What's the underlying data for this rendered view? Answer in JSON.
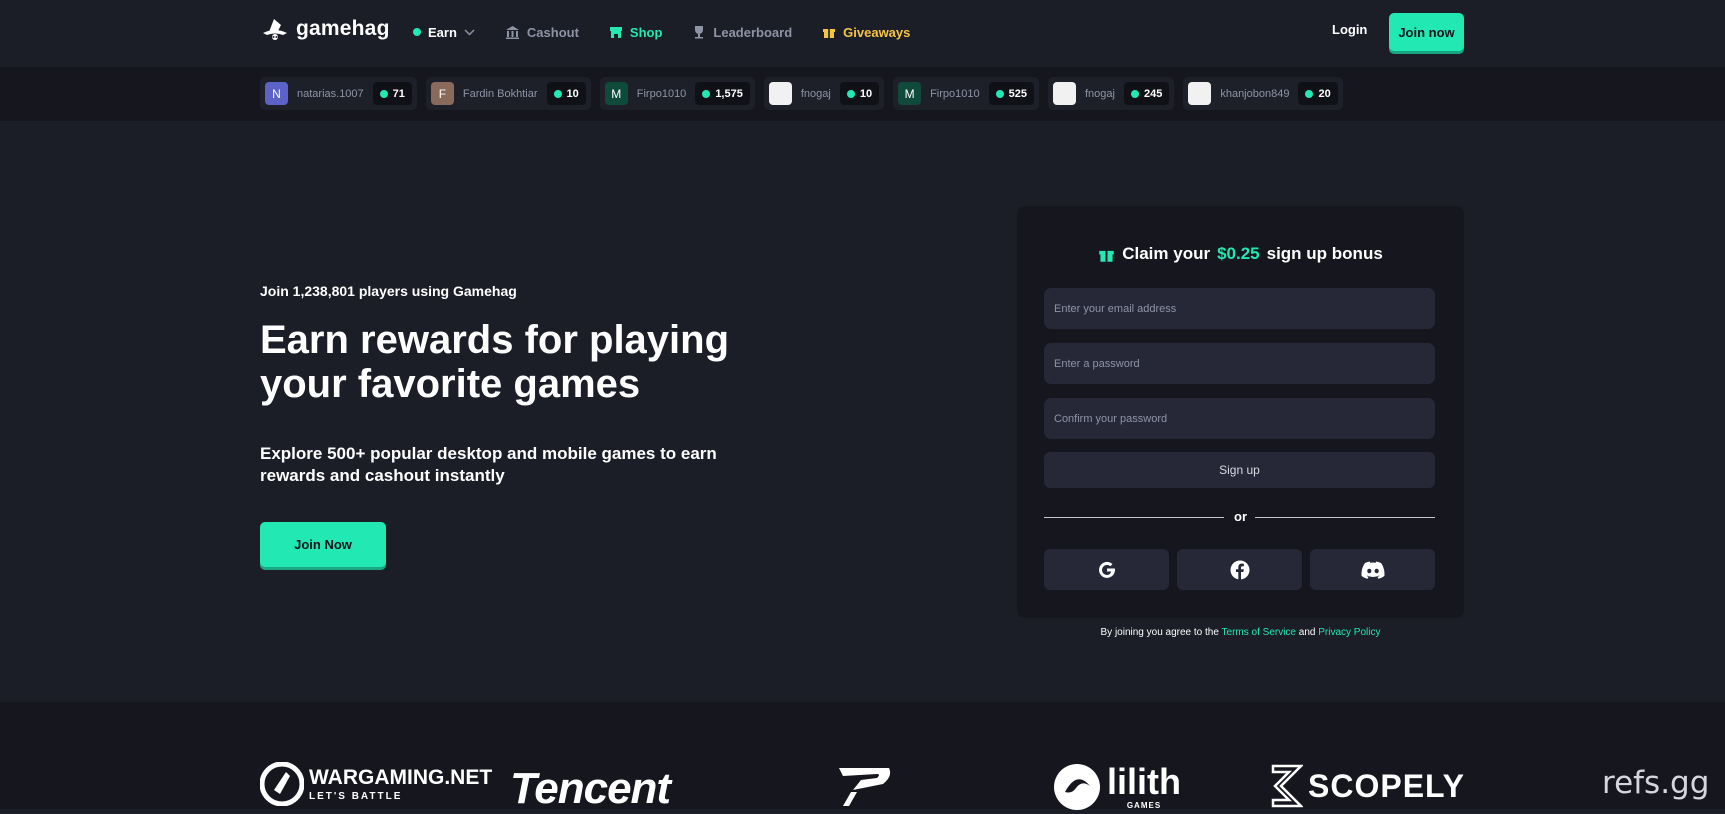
{
  "nav": {
    "logo_text": "gamehag",
    "earn": "Earn",
    "cashout": "Cashout",
    "shop": "Shop",
    "leaderboard": "Leaderboard",
    "giveaways": "Giveaways",
    "login": "Login",
    "join": "Join now"
  },
  "ticker": [
    {
      "initial": "N",
      "name": "natarias.1007",
      "value": "71",
      "color": "#5b63c8"
    },
    {
      "initial": "F",
      "name": "Fardin Bokhtiar",
      "value": "10",
      "color": "#8a6a5a"
    },
    {
      "initial": "M",
      "name": "Firpo1010",
      "value": "1,575",
      "color": "#0f4a3a"
    },
    {
      "initial": "",
      "name": "fnogaj",
      "value": "10",
      "color": "#f1f1f1"
    },
    {
      "initial": "M",
      "name": "Firpo1010",
      "value": "525",
      "color": "#0f4a3a"
    },
    {
      "initial": "",
      "name": "fnogaj",
      "value": "245",
      "color": "#f1f1f1"
    },
    {
      "initial": "",
      "name": "khanjobon849",
      "value": "20",
      "color": "#f1f1f1"
    }
  ],
  "hero": {
    "kicker": "Join 1,238,801 players using Gamehag",
    "title": "Earn rewards for playing your favorite games",
    "subtitle": "Explore 500+ popular desktop and mobile games to earn rewards and cashout instantly",
    "cta": "Join Now"
  },
  "signup": {
    "claim_prefix": "Claim your",
    "claim_amount": "$0.25",
    "claim_suffix": "sign up bonus",
    "email_placeholder": "Enter your email address",
    "password_placeholder": "Enter a password",
    "confirm_placeholder": "Confirm your password",
    "button": "Sign up",
    "or": "or",
    "terms_prefix": "By joining you agree to the",
    "terms_link": "Terms of Service",
    "terms_and": "and",
    "privacy_link": "Privacy Policy"
  },
  "brands": {
    "wargaming": "WARGAMING.NET",
    "wargaming_tag": "LET'S BATTLE",
    "tencent": "Tencent",
    "lilith": "lilith",
    "lilith_tag": "GAMES",
    "scopely": "SCOPELY"
  },
  "watermark": "refs.gg",
  "colors": {
    "accent": "#22e8b4",
    "gold": "#f5c544",
    "bg": "#1b1d27"
  }
}
